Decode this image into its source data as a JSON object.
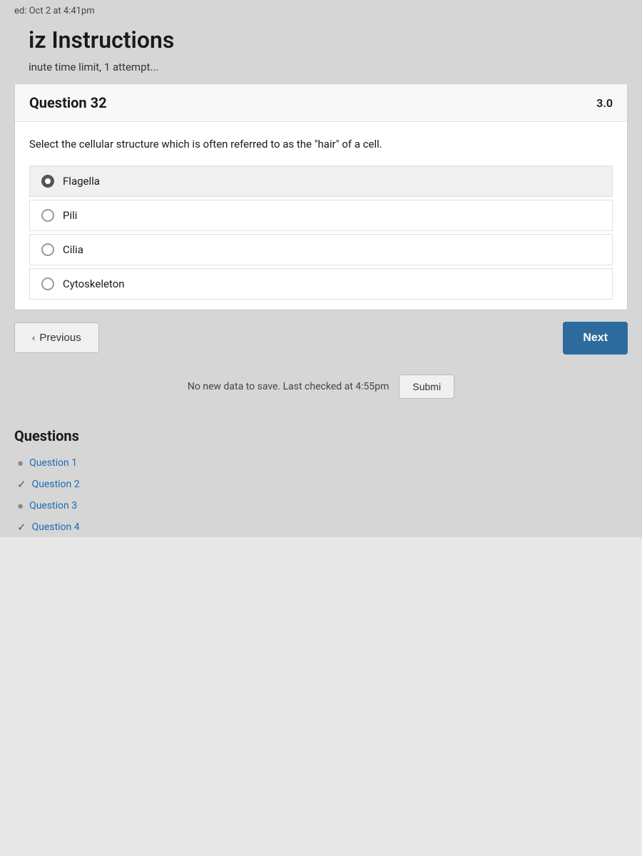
{
  "header": {
    "due_date": "ed: Oct 2 at 4:41pm",
    "title": "iz Instructions",
    "subtitle": "inute time limit, 1 attempt..."
  },
  "question": {
    "number": "Question 32",
    "points": "3.0",
    "text": "Select the cellular structure which is often referred to as the \"hair\" of a cell.",
    "options": [
      {
        "id": "flagella",
        "label": "Flagella",
        "selected": true
      },
      {
        "id": "pili",
        "label": "Pili",
        "selected": false
      },
      {
        "id": "cilia",
        "label": "Cilia",
        "selected": false
      },
      {
        "id": "cytoskeleton",
        "label": "Cytoskeleton",
        "selected": false
      }
    ]
  },
  "navigation": {
    "previous_label": "Previous",
    "next_label": "Next"
  },
  "save_status": {
    "text": "No new data to save. Last checked at 4:55pm",
    "submit_label": "Submi"
  },
  "sidebar": {
    "title": "Questions",
    "items": [
      {
        "label": "Question 1",
        "status": "circle-q"
      },
      {
        "label": "Question 2",
        "status": "check"
      },
      {
        "label": "Question 3",
        "status": "circle-q"
      },
      {
        "label": "Question 4",
        "status": "check"
      }
    ]
  }
}
